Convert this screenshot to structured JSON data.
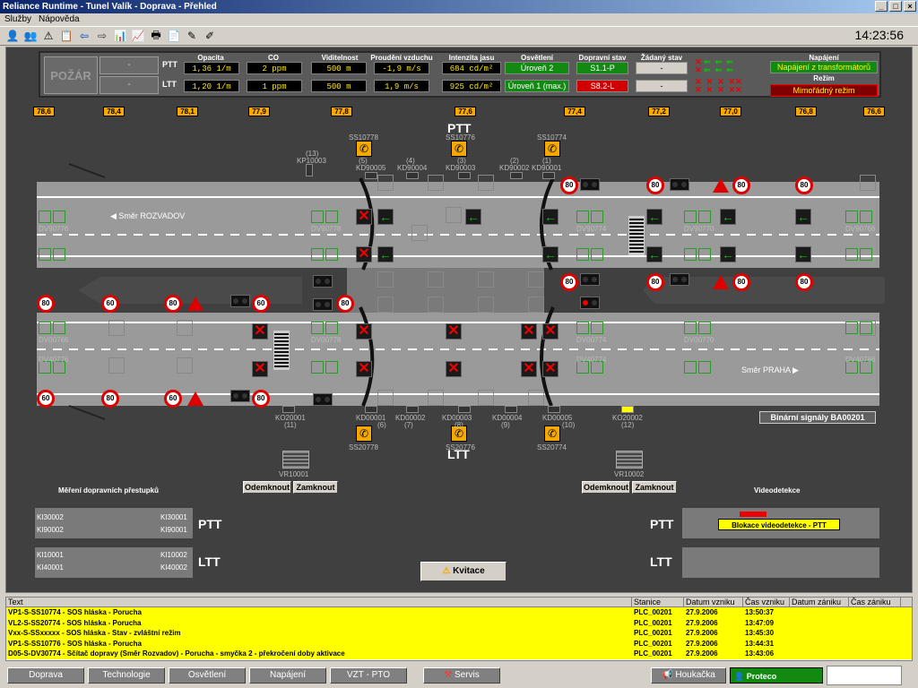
{
  "window": {
    "title": "Reliance Runtime - Tunel Valík - Doprava - Přehled"
  },
  "menu": [
    "Služby",
    "Nápověda"
  ],
  "clock": "14:23:56",
  "panel": {
    "pozar": "POŽÁR",
    "pozar_ptt": "-",
    "pozar_ltt": "-",
    "headers": {
      "opacita": "Opacita",
      "co": "CO",
      "viditelnost": "Viditelnost",
      "proudeni": "Proudění vzduchu",
      "intenzita": "Intenzita jasu",
      "osvetleni": "Osvětlení",
      "dopravni": "Dopravní stav",
      "zadany": "Žádaný stav",
      "napajeni": "Napájení",
      "rezim": "Režim"
    },
    "ptt": {
      "label": "PTT",
      "opacita": "1,36 1/m",
      "co": "2 ppm",
      "viditelnost": "500 m",
      "proudeni": "-1,9 m/s",
      "intenzita": "684 cd/m²",
      "osvetleni": "Úroveň 2",
      "dopravni": "S1.1-P",
      "zadany": "-"
    },
    "ltt": {
      "label": "LTT",
      "opacita": "1,20 1/m",
      "co": "1 ppm",
      "viditelnost": "500 m",
      "proudeni": "1,9 m/s",
      "intenzita": "925 cd/m²",
      "osvetleni": "Úroveň 1 (max.)",
      "dopravni": "S8.2-L",
      "zadany": "-"
    },
    "napajeni": "Napájení z transformátorů",
    "rezim": "Mimořádný režim"
  },
  "km_marks": [
    "78,6",
    "78,4",
    "78,1",
    "77,9",
    "77,8",
    "77,6",
    "77,4",
    "77,2",
    "77,0",
    "76,8",
    "76,6"
  ],
  "labels": {
    "ptt": "PTT",
    "ltt": "LTT",
    "smer_rozvadov": "◀ Směr ROZVADOV",
    "smer_praha": "Směr PRAHA ▶",
    "binary": "Binární signály BA00201",
    "mereni": "Měření dopravních přestupků",
    "videodetekce": "Videodetekce",
    "blokace": "Blokace videodetekce - PTT",
    "kvitace": "Kvitace",
    "odemknout": "Odemknout",
    "zamknout": "Zamknout",
    "vr1": "VR10001",
    "vr2": "VR10002",
    "ss_top": [
      "SS10778",
      "SS10776",
      "SS10774"
    ],
    "ss_bot": [
      "SS20778",
      "SS20776",
      "SS20774"
    ],
    "kd_top": [
      "KP10003",
      "KD90005",
      "KD90004",
      "KD90003",
      "KD90002",
      "KD90001"
    ],
    "kd_top_num": [
      "(13)",
      "(5)",
      "(4)",
      "(3)",
      "(2)",
      "(1)"
    ],
    "kd_bot": [
      "KO20001",
      "KD00001",
      "KD00002",
      "KD00003",
      "KD00004",
      "KD00005",
      "KO20002"
    ],
    "kd_bot_num": [
      "(11)",
      "(6)",
      "(7)",
      "(8)",
      "(9)",
      "(10)",
      "(12)"
    ],
    "dv": [
      "DV90776",
      "DV90778",
      "DV90774",
      "DV90770",
      "DV90766",
      "DV00766",
      "DV00778",
      "DV00774",
      "DV00770",
      "DV40776",
      "DV40774",
      "DV40766"
    ],
    "ki": [
      "KI30002",
      "KI90002",
      "KI30001",
      "KI90001",
      "KI10001",
      "KI40001",
      "KI10002",
      "KI40002"
    ]
  },
  "speeds": [
    "80",
    "60"
  ],
  "events": {
    "headers": [
      "Text",
      "Stanice",
      "Datum vzniku",
      "Čas vzniku",
      "Datum zániku",
      "Čas zániku"
    ],
    "rows": [
      [
        "VP1-S-SS10774 - SOS hláska - Porucha",
        "PLC_00201",
        "27.9.2006",
        "13:50:37",
        "",
        ""
      ],
      [
        "VL2-S-SS20774 - SOS hláska - Porucha",
        "PLC_00201",
        "27.9.2006",
        "13:47:09",
        "",
        ""
      ],
      [
        "Vxx-S-SSxxxxx - SOS hláska - Stav - zvláštní režim",
        "PLC_00201",
        "27.9.2006",
        "13:45:30",
        "",
        ""
      ],
      [
        "VP1-S-SS10776 - SOS hláska - Porucha",
        "PLC_00201",
        "27.9.2006",
        "13:44:31",
        "",
        ""
      ],
      [
        "D05-S-DV30774 - Sčítač dopravy (Směr Rozvadov) - Porucha - smyčka 2 - překročení doby aktivace",
        "PLC_00201",
        "27.9.2006",
        "13:43:06",
        "",
        ""
      ]
    ]
  },
  "nav": [
    "Doprava",
    "Technologie",
    "Osvětlení",
    "Napájení",
    "VZT - PTO",
    "Servis",
    "Houkačka",
    "Proteco"
  ]
}
